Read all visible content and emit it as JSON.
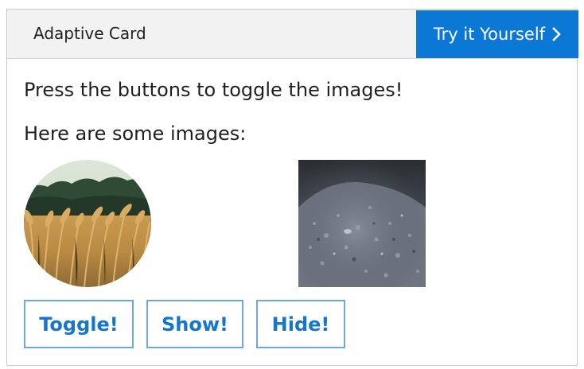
{
  "header": {
    "title": "Adaptive Card",
    "try_label": "Try it Yourself"
  },
  "body": {
    "instruction": "Press the buttons to toggle the images!",
    "images_label": "Here are some images:"
  },
  "actions": [
    {
      "label": "Toggle!"
    },
    {
      "label": "Show!"
    },
    {
      "label": "Hide!"
    }
  ],
  "colors": {
    "accent": "#0a78d4",
    "button_text": "#1377cf",
    "button_border": "#6fa7e6",
    "header_bg": "#f2f2f2"
  }
}
